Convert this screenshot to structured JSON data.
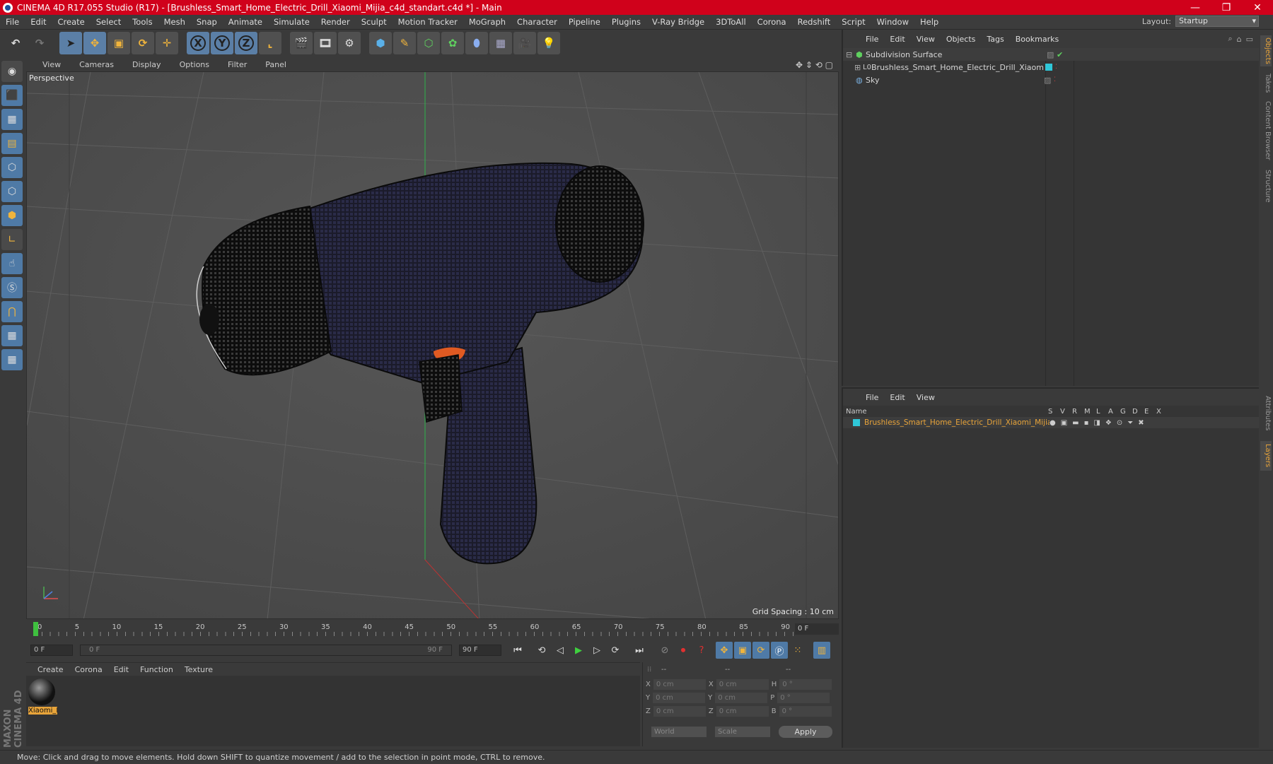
{
  "window": {
    "title": "CINEMA 4D R17.055 Studio (R17) - [Brushless_Smart_Home_Electric_Drill_Xiaomi_Mijia_c4d_standart.c4d *] - Main",
    "minimize": "—",
    "maximize": "❐",
    "close": "✕"
  },
  "menu": [
    "File",
    "Edit",
    "Create",
    "Select",
    "Tools",
    "Mesh",
    "Snap",
    "Animate",
    "Simulate",
    "Render",
    "Sculpt",
    "Motion Tracker",
    "MoGraph",
    "Character",
    "Pipeline",
    "Plugins",
    "V-Ray Bridge",
    "3DToAll",
    "Corona",
    "Redshift",
    "Script",
    "Window",
    "Help"
  ],
  "layout": {
    "label": "Layout:",
    "value": "Startup"
  },
  "toolbar": {
    "x_label": "X",
    "y_label": "Y",
    "z_label": "Z"
  },
  "viewport": {
    "menu": [
      "View",
      "Cameras",
      "Display",
      "Options",
      "Filter",
      "Panel"
    ],
    "camera": "Perspective",
    "grid_spacing": "Grid Spacing : 10 cm"
  },
  "timeline": {
    "ticks": [
      "0",
      "5",
      "10",
      "15",
      "20",
      "25",
      "30",
      "35",
      "40",
      "45",
      "50",
      "55",
      "60",
      "65",
      "70",
      "75",
      "80",
      "85",
      "90"
    ],
    "current_frame": "0 F",
    "start_field": "0 F",
    "range_start": "0 F",
    "range_end": "90 F",
    "end_field": "90 F"
  },
  "material_manager": {
    "menu": [
      "Create",
      "Corona",
      "Edit",
      "Function",
      "Texture"
    ],
    "materials": [
      {
        "name": "Xiaomi_I"
      }
    ]
  },
  "coordinates": {
    "headers": [
      "--",
      "--",
      "--"
    ],
    "rows": [
      {
        "a": "X",
        "av": "0 cm",
        "b": "X",
        "bv": "0 cm",
        "c": "H",
        "cv": "0 °"
      },
      {
        "a": "Y",
        "av": "0 cm",
        "b": "Y",
        "bv": "0 cm",
        "c": "P",
        "cv": "0 °"
      },
      {
        "a": "Z",
        "av": "0 cm",
        "b": "Z",
        "bv": "0 cm",
        "c": "B",
        "cv": "0 °"
      }
    ],
    "space": "World",
    "mode": "Scale",
    "apply": "Apply"
  },
  "object_manager": {
    "menu": [
      "File",
      "Edit",
      "View",
      "Objects",
      "Tags",
      "Bookmarks"
    ],
    "objects": [
      {
        "name": "Subdivision Surface"
      },
      {
        "name": "Brushless_Smart_Home_Electric_Drill_Xiaomi_Mijia"
      },
      {
        "name": "Sky"
      }
    ]
  },
  "layer_manager": {
    "menu": [
      "File",
      "Edit",
      "View"
    ],
    "columns": [
      "Name",
      "S",
      "V",
      "R",
      "M",
      "L",
      "A",
      "G",
      "D",
      "E",
      "X"
    ],
    "layers": [
      {
        "name": "Brushless_Smart_Home_Electric_Drill_Xiaomi_Mijia",
        "color": "#2fc7d8"
      }
    ]
  },
  "side_tabs": [
    "Objects",
    "Takes",
    "Content Browser",
    "Structure",
    "Attributes",
    "Layers"
  ],
  "brand": "MAXON CINEMA 4D",
  "status": "Move: Click and drag to move elements. Hold down SHIFT to quantize movement / add to the selection in point mode, CTRL to remove.",
  "colors": {
    "titlebar": "#d0011b",
    "accent": "#e8a43a",
    "tool_blue": "#4f7aa6"
  }
}
